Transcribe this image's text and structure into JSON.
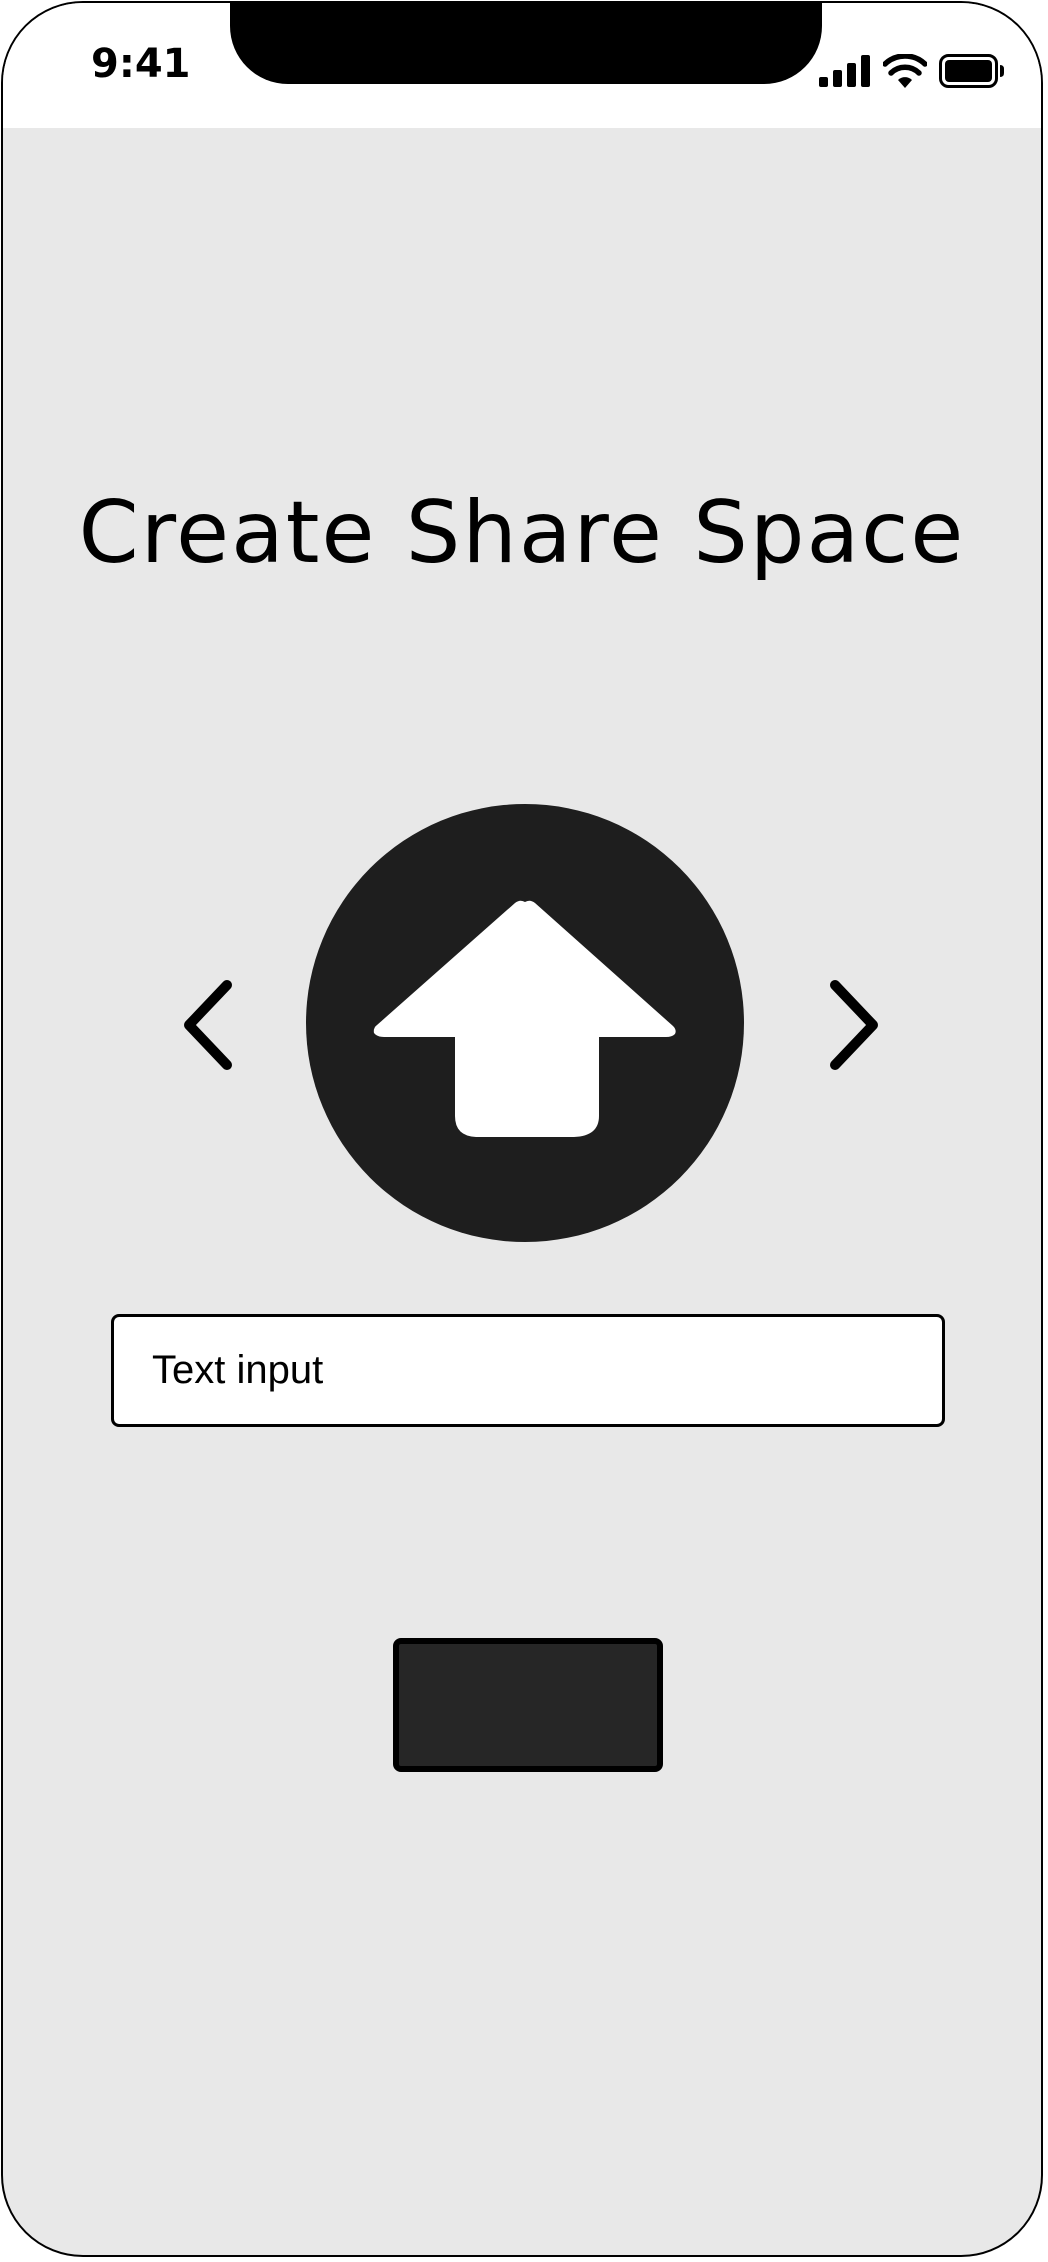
{
  "status_bar": {
    "time": "9:41",
    "icons": [
      "cellular-signal-icon",
      "wifi-icon",
      "battery-icon"
    ]
  },
  "main": {
    "title": "Create Share Space",
    "upload_icon": "upload-arrow-icon",
    "prev_icon": "chevron-left-icon",
    "next_icon": "chevron-right-icon",
    "input": {
      "placeholder": "Text input",
      "value": ""
    },
    "action_button_label": ""
  },
  "colors": {
    "background": "#e8e8e8",
    "status_bar": "#ffffff",
    "upload_circle": "#1e1e1e",
    "button": "#262626"
  }
}
